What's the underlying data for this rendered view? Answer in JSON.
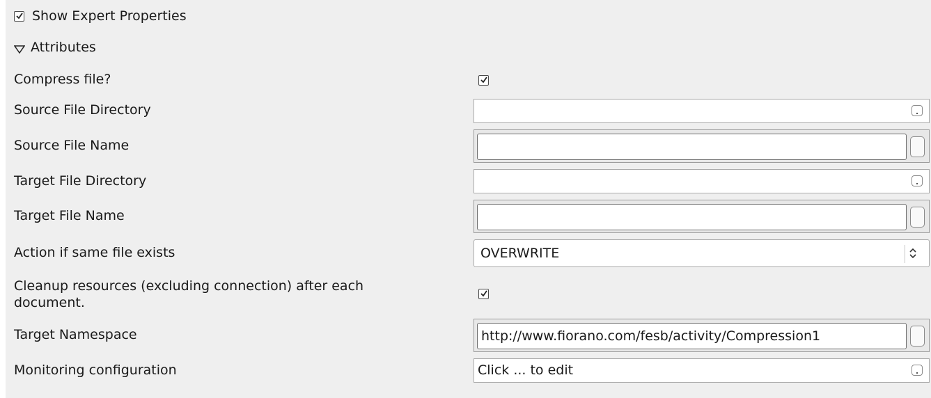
{
  "header": {
    "show_expert_label": "Show Expert Properties",
    "show_expert_checked": true,
    "section_label": "Attributes"
  },
  "rows": {
    "compress": {
      "label": "Compress file?",
      "checked": true
    },
    "source_dir": {
      "label": "Source File Directory",
      "value": ""
    },
    "source_name": {
      "label": "Source File Name",
      "value": ""
    },
    "target_dir": {
      "label": "Target File Directory",
      "value": ""
    },
    "target_name": {
      "label": "Target File Name",
      "value": ""
    },
    "action": {
      "label": "Action if same file exists",
      "value": "OVERWRITE"
    },
    "cleanup": {
      "label_line1": "Cleanup resources (excluding connection) after each",
      "label_line2": "document.",
      "checked": true
    },
    "namespace": {
      "label": "Target Namespace",
      "value": "http://www.fiorano.com/fesb/activity/Compression1"
    },
    "monitoring": {
      "label": "Monitoring configuration",
      "value": "Click ... to edit"
    }
  }
}
